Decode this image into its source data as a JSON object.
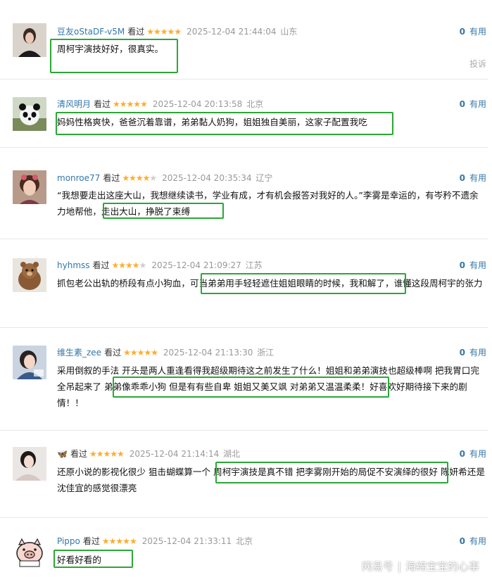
{
  "comments": [
    {
      "user": "豆友oStaDF-v5M",
      "watched": "看过",
      "stars": 5,
      "time": "2025-12-04 21:44:04",
      "loc": "山东",
      "votes": "0",
      "useful": "有用",
      "text": "周柯宇演技好好，很真实。"
    },
    {
      "user": "清风明月",
      "watched": "看过",
      "stars": 5,
      "time": "2025-12-04 20:13:58",
      "loc": "北京",
      "votes": "0",
      "useful": "有用",
      "text": "妈妈性格爽快，爸爸沉着靠谱，弟弟黏人奶狗，姐姐独自美丽，这家子配置我吃"
    },
    {
      "user": "monroe77",
      "watched": "看过",
      "stars": 4,
      "time": "2025-12-04 20:35:34",
      "loc": "辽宁",
      "votes": "0",
      "useful": "有用",
      "text": "“我想要走出这座大山，我想继续读书，学业有成，才有机会报答对我好的人。”李雾是幸运的，有岑矜不遗余力地帮他，走出大山，挣脱了束缚"
    },
    {
      "user": "hyhmss",
      "watched": "看过",
      "stars": 4,
      "time": "2025-12-04 21:09:27",
      "loc": "江苏",
      "votes": "0",
      "useful": "有用",
      "text": "抓包老公出轨的桥段有点小狗血，可当弟弟用手轻轻遮住姐姐眼睛的时候，我和解了，谁懂这段周柯宇的张力"
    },
    {
      "user": "维生素_zee",
      "watched": "看过",
      "stars": 5,
      "time": "2025-12-04 21:13:30",
      "loc": "浙江",
      "votes": "0",
      "useful": "有用",
      "text": "采用倒叙的手法 开头是两人重逢看得我超级期待这之前发生了什么！姐姐和弟弟演技也超级棒啊 把我胃口完全吊起来了 弟弟像乖乖小狗 但是有有些自卑 姐姐又美又飒 对弟弟又温温柔柔！好喜欢好期待接下来的剧情！！"
    },
    {
      "user": "🦋",
      "watched": "看过",
      "stars": 5,
      "time": "2025-12-04 21:14:14",
      "loc": "湖北",
      "votes": "0",
      "useful": "有用",
      "text": "还原小说的影视化很少 狙击蝴蝶算一个 周柯宇演技是真不错 把李雾刚开始的局促不安演绎的很好 陈妍希还是沈佳宜的感觉很漂亮"
    },
    {
      "user": "Pippo",
      "watched": "看过",
      "stars": 5,
      "time": "2025-12-04 21:33:11",
      "loc": "北京",
      "votes": "0",
      "useful": "有用",
      "text": "好看好看的"
    }
  ],
  "report_label": "投诉",
  "watermark": {
    "brand": "网易号",
    "account": "海绵宝宝的心事"
  }
}
